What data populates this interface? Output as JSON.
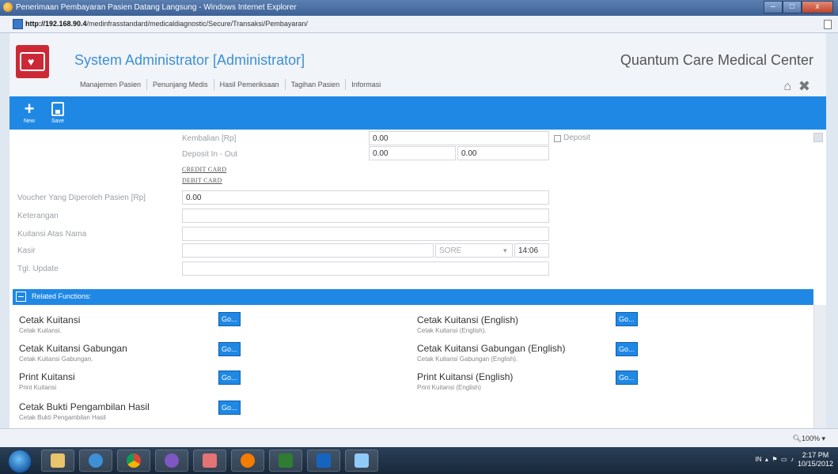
{
  "window": {
    "title": "Penerimaan Pembayaran Pasien Datang Langsung - Windows Internet Explorer",
    "controls": {
      "minimize": "–",
      "maximize": "□",
      "close": "x"
    }
  },
  "address": {
    "url_host": "http://192.168.90.4",
    "url_path": "/medinfrasstandard/medicaldiagnostic/Secure/Transaksi/Pembayaran/"
  },
  "header": {
    "user_title": "System Administrator [Administrator]",
    "clinic_name": "Quantum Care Medical Center",
    "menu": [
      "Manajemen Pasien",
      "Penunjang Medis",
      "Hasil Pemeriksaan",
      "Tagihan Pasien",
      "Informasi"
    ]
  },
  "toolbar": {
    "new_label": "New",
    "save_label": "Save"
  },
  "form": {
    "kembalian": {
      "label": "Kembalian [Rp]",
      "value": "0.00"
    },
    "deposit_label": "Deposit",
    "deposit_in_out": {
      "label": "Deposit In - Out",
      "value_in": "0.00",
      "value_out": "0.00"
    },
    "credit_card": "CREDIT CARD",
    "debit_card": "DEBIT CARD",
    "voucher": {
      "label": "Voucher Yang Diperoleh Pasien [Rp]",
      "value": "0.00"
    },
    "keterangan": {
      "label": "Keterangan",
      "value": ""
    },
    "kuitansi_atas_nama": {
      "label": "Kuitansi Atas Nama",
      "value": ""
    },
    "kasir": {
      "label": "Kasir",
      "value": "",
      "shift": "SORE",
      "time": "14:06"
    },
    "tgl_update": {
      "label": "Tgl. Update",
      "value": ""
    }
  },
  "related": {
    "header": "Related Functions:",
    "go_label": "Go...",
    "items": [
      {
        "title": "Cetak Kuitansi",
        "sub": "Cetak Kuitansi."
      },
      {
        "title": "Cetak Kuitansi (English)",
        "sub": "Cetak Kuitansi (English)."
      },
      {
        "title": "Cetak Kuitansi Gabungan",
        "sub": "Cetak Kuitansi Gabungan."
      },
      {
        "title": "Cetak Kuitansi Gabungan (English)",
        "sub": "Cetak Kuitansi Gabungan (English)."
      },
      {
        "title": "Print Kuitansi",
        "sub": "Print Kuitansi"
      },
      {
        "title": "Print Kuitansi (English)",
        "sub": "Print Kuitansi (English)"
      },
      {
        "title": "Cetak Bukti Pengambilan Hasil",
        "sub": "Cetak Bukti Pengambilan Hasil"
      }
    ]
  },
  "statusbar": {
    "zoom": "100%"
  },
  "taskbar": {
    "tray_lang": "IN",
    "time": "2:17 PM",
    "date": "10/15/2012",
    "apps": [
      "explorer",
      "internet-explorer",
      "chrome",
      "app-infinity",
      "app-people",
      "firefox",
      "excel",
      "word",
      "paint"
    ]
  },
  "colors": {
    "accent": "#1f88e5",
    "brand_title": "#3d8fd6",
    "logo_red": "#cc2936"
  }
}
